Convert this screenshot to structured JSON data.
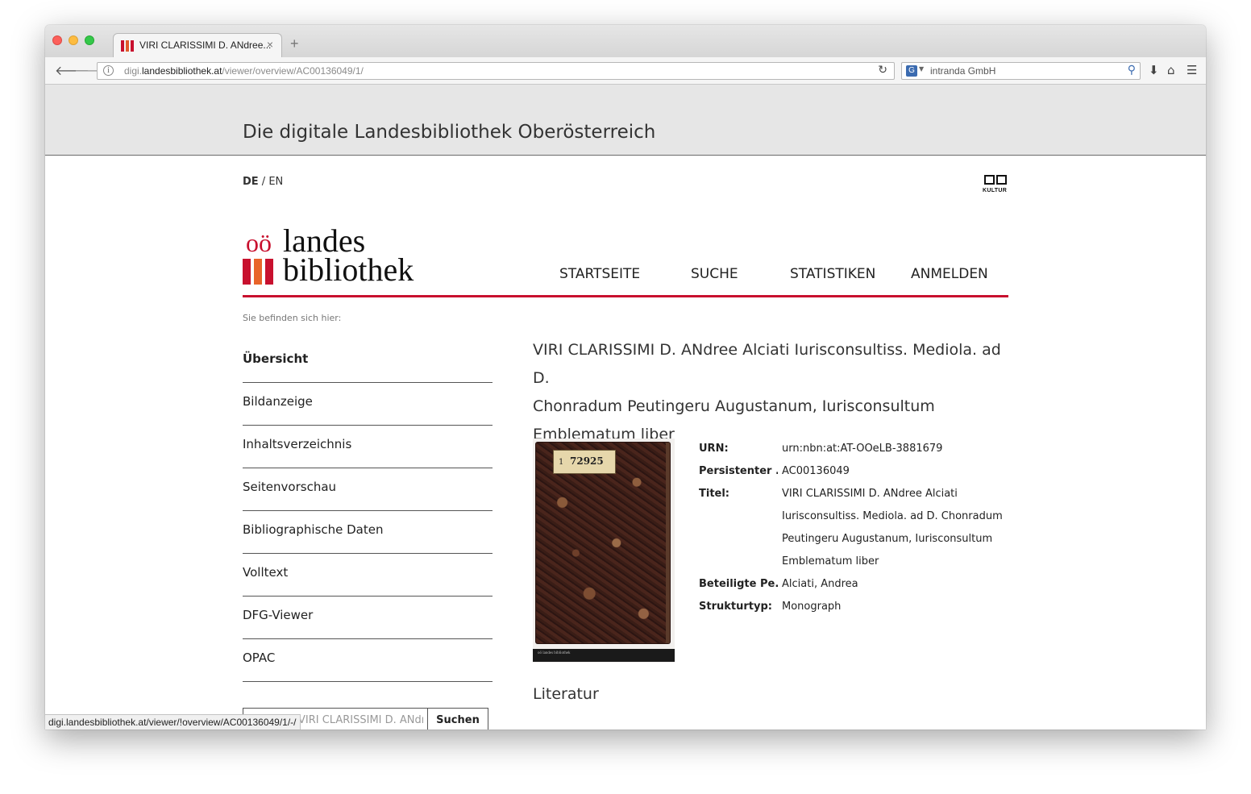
{
  "browser": {
    "tab_title": "VIRI CLARISSIMI D. ANdree...",
    "tab_close": "×",
    "new_tab": "+",
    "url_prefix": "digi.",
    "url_host": "landesbibliothek.at",
    "url_path": "/viewer/overview/AC00136049/1/",
    "search_text": "intranda GmbH",
    "status_url": "digi.landesbibliothek.at/viewer/!overview/AC00136049/1/-/",
    "favicon_colors": [
      "#c8102e",
      "#e05a2b",
      "#c8102e"
    ]
  },
  "site": {
    "banner_title": "Die digitale Landesbibliothek Oberösterreich",
    "lang_de": "DE",
    "lang_sep": " / ",
    "lang_en": "EN",
    "kultur_logo_text": "KULTUR",
    "logo": {
      "oo": "oö",
      "line1": "landes",
      "line2": "bibliothek"
    },
    "accent_color": "#c8102e",
    "main_nav": [
      "STARTSEITE",
      "SUCHE",
      "STATISTIKEN",
      "ANMELDEN"
    ],
    "breadcrumb": "Sie befinden sich hier:"
  },
  "sidenav": [
    {
      "label": "Übersicht",
      "active": true
    },
    {
      "label": "Bildanzeige"
    },
    {
      "label": "Inhaltsverzeichnis"
    },
    {
      "label": "Seitenvorschau"
    },
    {
      "label": "Bibliographische Daten"
    },
    {
      "label": "Volltext"
    },
    {
      "label": "DFG-Viewer"
    },
    {
      "label": "OPAC"
    }
  ],
  "search": {
    "value": "VIRI CLARISSIMI D. ANdree",
    "button": "Suchen"
  },
  "record": {
    "title_lines": [
      "VIRI CLARISSIMI D. ANdree Alciati Iurisconsultiss. Mediola. ad D.",
      "Chonradum Peutingeru Augustanum, Iurisconsultum",
      "Emblematum liber"
    ],
    "cover_label_prefix": "1",
    "cover_label_number": "72925",
    "cover_footer": "oö landes bibliothek",
    "metadata": [
      {
        "label": "URN:",
        "value": [
          "urn:nbn:at:AT-OOeLB-3881679"
        ]
      },
      {
        "label": "Persistenter ...",
        "value": [
          "AC00136049"
        ]
      },
      {
        "label": "Titel:",
        "value": [
          "VIRI CLARISSIMI D. ANdree Alciati",
          "Iurisconsultiss. Mediola. ad D. Chonradum",
          "Peutingeru Augustanum, Iurisconsultum",
          "Emblematum liber"
        ]
      },
      {
        "label": "Beteiligte Pe...",
        "value": [
          "Alciati, Andrea"
        ]
      },
      {
        "label": "Strukturtyp:",
        "value": [
          "Monograph"
        ]
      }
    ],
    "literatur_heading": "Literatur"
  }
}
